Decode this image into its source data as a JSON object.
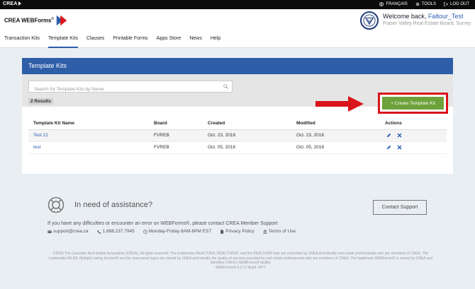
{
  "topbar": {
    "brand": "CREA",
    "links": [
      {
        "label": "FRANÇAIS",
        "icon": "globe-icon"
      },
      {
        "label": "TOOLS",
        "icon": "gear-icon"
      },
      {
        "label": "LOG OUT",
        "icon": "logout-icon"
      }
    ]
  },
  "header": {
    "logo_text": "CREA WEBForms",
    "logo_reg": "®",
    "welcome_prefix": "Welcome back,",
    "user_name": "Faltour_Test",
    "board_name": "Fraser Valley Real Estate Board, Surrey"
  },
  "nav": [
    {
      "label": "Transaction Kits",
      "active": false
    },
    {
      "label": "Template Kits",
      "active": true
    },
    {
      "label": "Clauses",
      "active": false
    },
    {
      "label": "Printable Forms",
      "active": false
    },
    {
      "label": "Apps Store",
      "active": false
    },
    {
      "label": "News",
      "active": false
    },
    {
      "label": "Help",
      "active": false
    }
  ],
  "panel": {
    "title": "Template Kits",
    "search_placeholder": "Search for Template Kits by Name",
    "results": "2 Results",
    "create_label": "+ Create Template Kit"
  },
  "table": {
    "headers": [
      "Template Kit Name",
      "Board",
      "Created",
      "Modified",
      "Actions"
    ],
    "rows": [
      {
        "name": "Test 22",
        "board": "FVREB",
        "created": "Oct. 23, 2018",
        "modified": "Oct. 23, 2018"
      },
      {
        "name": "test",
        "board": "FVREB",
        "created": "Oct. 05, 2018",
        "modified": "Oct. 05, 2018"
      }
    ]
  },
  "footer": {
    "assist_title": "In need of assistance?",
    "contact_button": "Contact Support",
    "help_text": "If you have any difficulties or encounter an error on WEBForms®, please contact CREA Member Support",
    "contacts": [
      {
        "label": "support@crea.ca",
        "icon": "envelope-icon"
      },
      {
        "label": "1.888.237.7945",
        "icon": "phone-icon"
      },
      {
        "label": "Monday-Friday 8AM-8PM EST",
        "icon": "clock-icon"
      },
      {
        "label": "Privacy Policy",
        "icon": "document-icon"
      },
      {
        "label": "Terms of Use",
        "icon": "bank-icon"
      }
    ],
    "legal_1": "©2018 The Canadian Real Estate Association (CREA). All rights reserved. The trademarks REALTOR®, REALTORS®, and the REALTOR® logo are controlled by CREA and identify real estate professionals who are members of CREA. The trademarks MLS®, Multiple Listing Service® and the associated logos are owned by CREA and identify the quality of services provided by real estate professionals who are members of CREA. The trademark WEBForms® is owned by CREA and identifies CREA's WEBForms® facility.",
    "legal_2": "WEBForms® 5.0.17 Build: 4077"
  },
  "colors": {
    "panel_header": "#2e5ea8",
    "create_button": "#6da23a",
    "highlight_box": "#d9141b",
    "arrow": "#d9141b",
    "link": "#2a5db0"
  }
}
